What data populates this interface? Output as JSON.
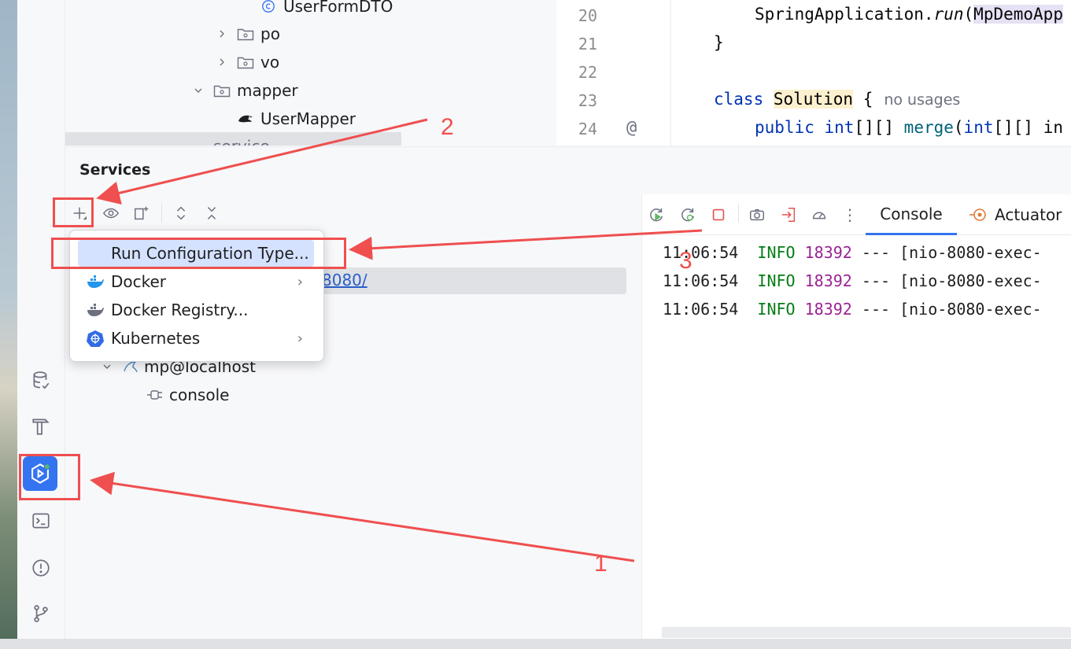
{
  "project_tree": {
    "items": [
      {
        "label": "UserFormDTO",
        "kind": "class"
      },
      {
        "label": "po",
        "kind": "folder"
      },
      {
        "label": "vo",
        "kind": "folder"
      },
      {
        "label": "mapper",
        "kind": "folder"
      },
      {
        "label": "UserMapper",
        "kind": "mapper"
      },
      {
        "label": "service",
        "kind": "folder"
      }
    ]
  },
  "editor": {
    "line_numbers": [
      "20",
      "21",
      "22",
      "23",
      "24"
    ],
    "gutter_marker": "@",
    "lines": {
      "l20_obj": "SpringApplication.",
      "l20_fn": "run",
      "l20_paren": "(",
      "l20_arg": "MpDemoApp",
      "l21": "}",
      "l23_kw": "class",
      "l23_name": "Solution",
      "l23_brace": "{",
      "l23_hint": "no usages",
      "l24_kw1": "public",
      "l24_kw2": "int",
      "l24_rest1": "[][] ",
      "l24_fn": "merge",
      "l24_paren": "(",
      "l24_kw3": "int",
      "l24_rest2": "[][] in"
    }
  },
  "services": {
    "title": "Services",
    "tabs": [
      {
        "label": "Console",
        "active": true
      },
      {
        "label": "Actuator",
        "active": false
      }
    ],
    "tree": {
      "link_fragment": "8080/",
      "db_label": "mp@localhost",
      "console_label": "console"
    },
    "log_lines": [
      {
        "time": "11:06:54",
        "level": "INFO",
        "pid": "18392",
        "rest": "--- [nio-8080-exec-"
      },
      {
        "time": "11:06:54",
        "level": "INFO",
        "pid": "18392",
        "rest": "--- [nio-8080-exec-"
      },
      {
        "time": "11:06:54",
        "level": "INFO",
        "pid": "18392",
        "rest": "--- [nio-8080-exec-"
      }
    ]
  },
  "popup_menu": {
    "items": [
      {
        "label": "Run Configuration Type...",
        "icon": "none",
        "submenu": false
      },
      {
        "label": "Docker",
        "icon": "docker-icon",
        "submenu": true
      },
      {
        "label": "Docker Registry...",
        "icon": "docker-registry-icon",
        "submenu": false
      },
      {
        "label": "Kubernetes",
        "icon": "kubernetes-icon",
        "submenu": true
      }
    ],
    "submenu_arrow": "›"
  },
  "annotations": {
    "labels": [
      "1",
      "2",
      "3"
    ],
    "color": "#ef4f4f"
  },
  "colors": {
    "accent": "#3574f0",
    "annotation": "#ef4f4f",
    "log_info": "#067d17",
    "log_pid": "#9b2393"
  }
}
